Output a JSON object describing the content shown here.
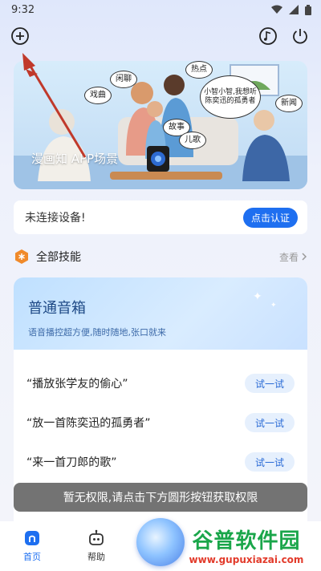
{
  "status_bar": {
    "time": "9:32"
  },
  "banner": {
    "caption": "漫画知 APP场景",
    "bubbles": {
      "xianliao": "闲聊",
      "redian": "热点",
      "xiqu": "戏曲",
      "xiaozhi": "小智小智,我想听陈奕迅的孤勇者",
      "xinwen": "新闻",
      "gushi": "故事",
      "erge": "儿歌"
    }
  },
  "device": {
    "status_text": "未连接设备!",
    "auth_label": "点击认证"
  },
  "skills": {
    "title": "全部技能",
    "view_more": "查看"
  },
  "skill_card": {
    "title": "普通音箱",
    "subtitle": "语音播控超方便,随时随地,张口就来",
    "samples": [
      {
        "text": "“播放张学友的偷心”",
        "button": "试一试"
      },
      {
        "text": "“放一首陈奕迅的孤勇者”",
        "button": "试一试"
      },
      {
        "text": "“来一首刀郎的歌”",
        "button": "试一试"
      }
    ]
  },
  "toast": {
    "text": "暂无权限,请点击下方圆形按钮获取权限"
  },
  "nav": {
    "home_label": "首页",
    "help_label": "帮助"
  },
  "watermark": {
    "title": "谷普软件园",
    "url": "www.gupuxiazai.com"
  },
  "colors": {
    "accent": "#1e6ff0",
    "skill_icon": "#f08a2a",
    "watermark_green": "#1aa64a",
    "watermark_red": "#e23a2a"
  }
}
